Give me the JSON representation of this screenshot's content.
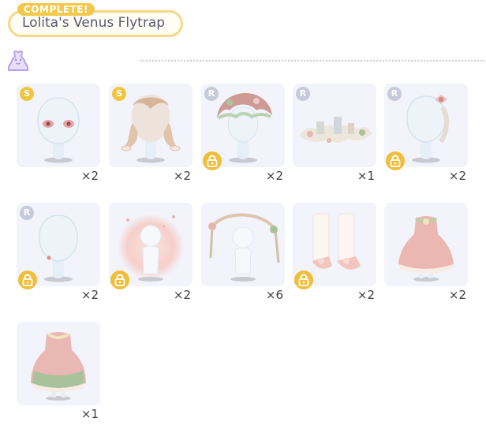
{
  "header": {
    "badge": "COMPLETE!",
    "title": "Lolita's Venus Flytrap",
    "set_icon": "dress-outline-icon"
  },
  "colors": {
    "accent_gold": "#f2c94c",
    "rarity_r": "#c7cad8",
    "card_bg": "#f3f3fb",
    "lock": "#f1be3b"
  },
  "items": [
    {
      "rarity": "S",
      "quantity": "×2",
      "locked": false,
      "art": "eyes"
    },
    {
      "rarity": "S",
      "quantity": "×2",
      "locked": false,
      "art": "hair-twin-braids"
    },
    {
      "rarity": "R",
      "quantity": "×2",
      "locked": true,
      "art": "bonnet-headdress"
    },
    {
      "rarity": "R",
      "quantity": "×1",
      "locked": false,
      "art": "tea-party-props"
    },
    {
      "rarity": "R",
      "quantity": "×2",
      "locked": true,
      "art": "hair-accessory-braid"
    },
    {
      "rarity": "R",
      "quantity": "×2",
      "locked": true,
      "art": "earrings"
    },
    {
      "rarity": "",
      "quantity": "×2",
      "locked": true,
      "art": "pink-aura"
    },
    {
      "rarity": "",
      "quantity": "×6",
      "locked": false,
      "art": "flower-garland"
    },
    {
      "rarity": "",
      "quantity": "×2",
      "locked": true,
      "art": "lace-socks"
    },
    {
      "rarity": "",
      "quantity": "×2",
      "locked": false,
      "art": "pink-dress"
    },
    {
      "rarity": "",
      "quantity": "×1",
      "locked": false,
      "art": "green-pink-dress"
    }
  ]
}
